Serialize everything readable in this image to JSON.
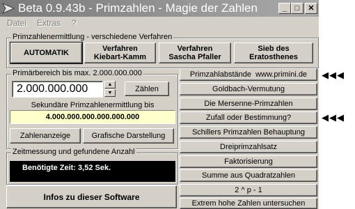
{
  "window": {
    "title": "Beta 0.9.43b - Primzahlen - Magie der Zahlen",
    "controls": [
      "_",
      "□",
      "✕"
    ]
  },
  "menu": {
    "items": [
      "Datei",
      "Extras",
      "?"
    ]
  },
  "methods": {
    "group_label": "Primzahlenermittlung - verschiedene Verfahren",
    "automatik": "AUTOMATIK",
    "kiebart_line1": "Verfahren",
    "kiebart_line2": "Kiebart-Kamm",
    "sascha_line1": "Verfahren",
    "sascha_line2": "Sascha Pfaller",
    "sieb_line1": "Sieb des",
    "sieb_line2": "Eratosthenes"
  },
  "range": {
    "group_label": "Primärbereich bis max. 2.000.000.000",
    "value": "2.000.000.000",
    "count_button": "Zählen",
    "secondary_label": "Sekundäre Primzahlenermittlung bis",
    "secondary_value": "4.000.000.000.000.000.000",
    "show_numbers_button": "Zahlenanzeige",
    "graphic_button": "Grafische Darstellung"
  },
  "timing": {
    "group_label": "Zeitmessung und gefundene Anzahl",
    "result": "Benötigte Zeit: 3,52 Sek."
  },
  "info_button": "Infos zu dieser Software",
  "right_buttons": [
    "Primzahlabstände  www.primini.de",
    "Goldbach-Vermutung",
    "Die Mersenne-Primzahlen",
    "Zufall oder Bestimmung?",
    "Schillers Primzahlen Behauptung",
    "Dreiprimzahlsatz",
    "Faktorisierung",
    "Summe aus Quadratzahlen",
    "2 ^ p - 1",
    "Extrem hohe Zahlen untersuchen"
  ],
  "pointer_arrows": "◀◀◀",
  "colors": {
    "titlebar": "#8a8a8a",
    "face": "#d4d0c8",
    "highlight_field": "#ffffcc",
    "result_bg": "#000000"
  }
}
